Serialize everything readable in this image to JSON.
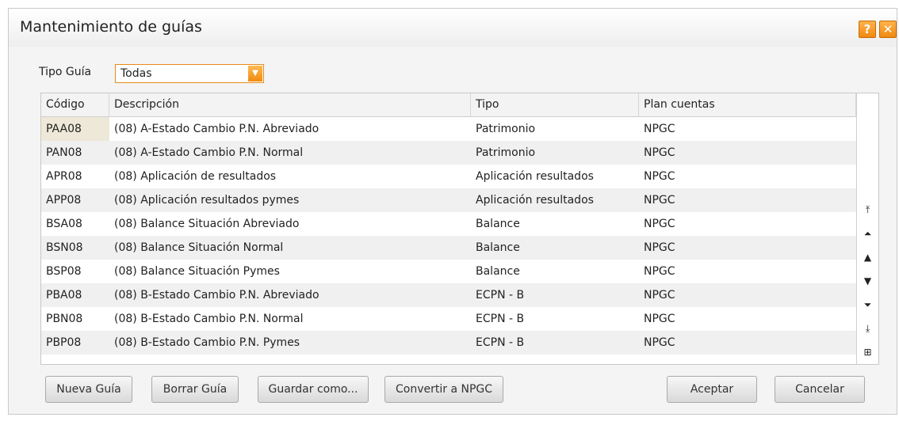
{
  "window": {
    "title": "Mantenimiento de guías",
    "help_label": "?",
    "close_label": "✕"
  },
  "filter": {
    "label": "Tipo Guía",
    "selected": "Todas"
  },
  "grid": {
    "headers": [
      "Código",
      "Descripción",
      "Tipo",
      "Plan cuentas"
    ],
    "rows": [
      [
        "PAA08",
        "(08) A-Estado Cambio P.N. Abreviado",
        "Patrimonio",
        "NPGC"
      ],
      [
        "PAN08",
        "(08) A-Estado Cambio P.N. Normal",
        "Patrimonio",
        "NPGC"
      ],
      [
        "APR08",
        "(08) Aplicación de resultados",
        "Aplicación resultados",
        "NPGC"
      ],
      [
        "APP08",
        "(08) Aplicación resultados pymes",
        "Aplicación resultados",
        "NPGC"
      ],
      [
        "BSA08",
        "(08) Balance Situación Abreviado",
        "Balance",
        "NPGC"
      ],
      [
        "BSN08",
        "(08) Balance Situación Normal",
        "Balance",
        "NPGC"
      ],
      [
        "BSP08",
        "(08) Balance Situación Pymes",
        "Balance",
        "NPGC"
      ],
      [
        "PBA08",
        "(08) B-Estado Cambio P.N. Abreviado",
        "ECPN - B",
        "NPGC"
      ],
      [
        "PBN08",
        "(08) B-Estado Cambio P.N. Normal",
        "ECPN - B",
        "NPGC"
      ],
      [
        "PBP08",
        "(08) B-Estado Cambio P.N. Pymes",
        "ECPN - B",
        "NPGC"
      ]
    ],
    "scroll_icons": [
      "first-page-icon",
      "previous-page-icon",
      "previous-row-icon",
      "next-row-icon",
      "next-page-icon",
      "last-page-icon",
      "export-icon"
    ]
  },
  "buttons": {
    "nueva": "Nueva Guía",
    "borrar": "Borrar Guía",
    "guardar": "Guardar como...",
    "convertir": "Convertir a NPGC",
    "aceptar": "Aceptar",
    "cancelar": "Cancelar"
  },
  "colors": {
    "accent": "#f08a10",
    "row_alt": "#f0f0f0",
    "selected_code": "#eee8d8"
  }
}
